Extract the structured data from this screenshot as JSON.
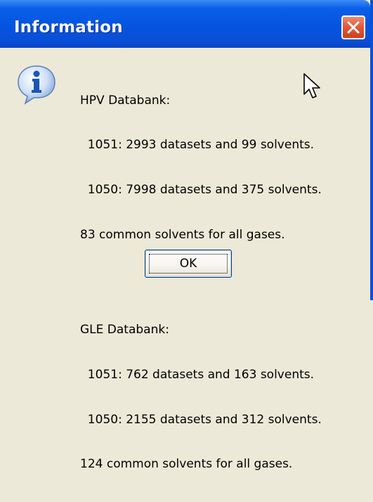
{
  "window": {
    "title": "Information",
    "close_icon": "close-icon",
    "title_color": "#ffffff",
    "titlebar_color": "#0454e0",
    "close_color": "#e25b3a"
  },
  "dialog": {
    "icon": "info-icon",
    "lines": [
      "HPV Databank:",
      "  1051: 2993 datasets and 99 solvents.",
      "  1050: 7998 datasets and 375 solvents.",
      "83 common solvents for all gases.",
      "GLE Databank:",
      "  1051: 762 datasets and 163 solvents.",
      "  1050: 2155 datasets and 312 solvents.",
      "124 common solvents for all gases."
    ],
    "ok_label": "OK"
  }
}
